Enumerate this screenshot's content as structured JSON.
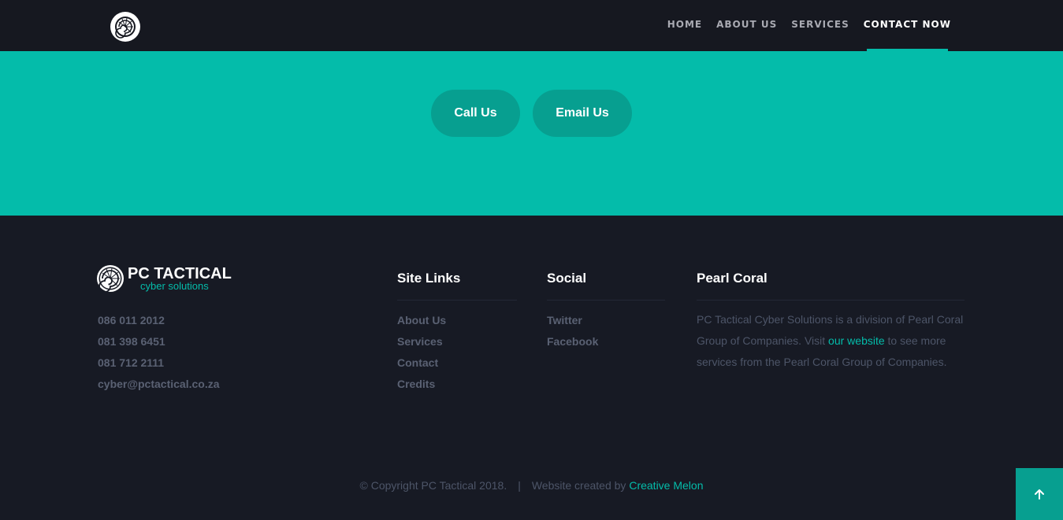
{
  "nav": {
    "links": [
      "HOME",
      "ABOUT US",
      "SERVICES",
      "CONTACT NOW"
    ],
    "active_index": 3
  },
  "hero": {
    "call_label": "Call Us",
    "email_label": "Email Us"
  },
  "brand": {
    "title": "PC TACTICAL",
    "subtitle": "cyber solutions"
  },
  "contact": {
    "items": [
      "086 011 2012",
      "081 398 6451",
      "081 712 2111",
      "cyber@pctactical.co.za"
    ]
  },
  "site_links": {
    "heading": "Site Links",
    "items": [
      "About Us",
      "Services",
      "Contact",
      "Credits"
    ]
  },
  "social": {
    "heading": "Social",
    "items": [
      "Twitter",
      "Facebook"
    ]
  },
  "pearl": {
    "heading": "Pearl Coral",
    "text_before": "PC Tactical Cyber Solutions is a division of Pearl Coral Group of Companies. Visit ",
    "link": "our website",
    "text_after": " to see more services from the Pearl Coral Group of Companies."
  },
  "footer": {
    "copyright": "© Copyright PC Tactical 2018.",
    "separator": "|",
    "created_by": "Website created by ",
    "creator": "Creative Melon"
  },
  "icons": {
    "logo": "nautilus-shell-icon",
    "back_to_top": "arrow-up-icon"
  },
  "colors": {
    "accent": "#04bcaa",
    "accent_dark": "#079f90",
    "nav_bg": "#161820",
    "footer_bg": "#171a24"
  }
}
